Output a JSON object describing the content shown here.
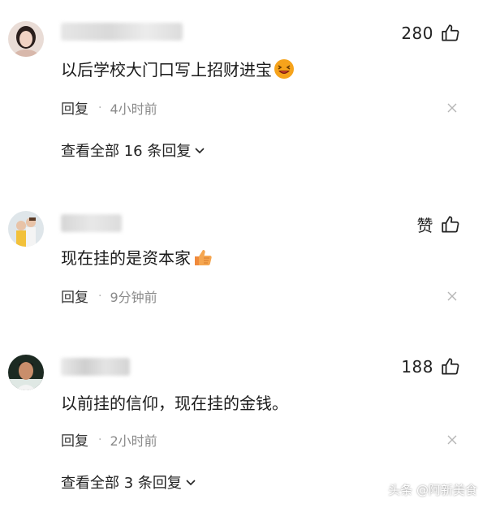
{
  "comments": [
    {
      "like_count": "280",
      "text": "以后学校大门口写上招财进宝",
      "emoji": "grinning-emoji",
      "reply_label": "回复",
      "separator": "·",
      "time": "4小时前",
      "view_all": "查看全部 16 条回复"
    },
    {
      "like_count": "赞",
      "text": "现在挂的是资本家",
      "emoji": "thumbs-up-emoji",
      "reply_label": "回复",
      "separator": "·",
      "time": "9分钟前"
    },
    {
      "like_count": "188",
      "text": "以前挂的信仰，现在挂的金钱。",
      "reply_label": "回复",
      "separator": "·",
      "time": "2小时前",
      "view_all": "查看全部 3 条回复"
    }
  ],
  "watermark": "头条 @阿新美食"
}
